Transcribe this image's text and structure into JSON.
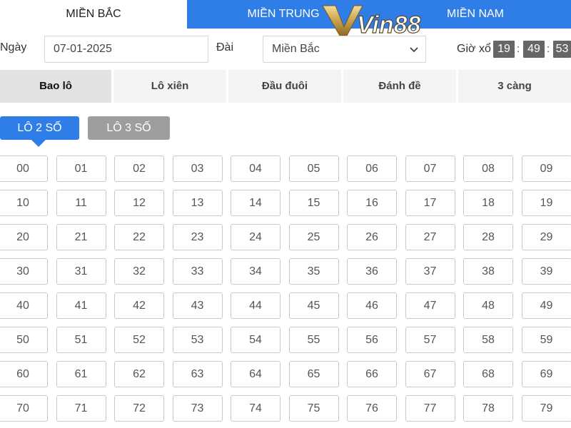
{
  "regions": {
    "items": [
      "MIỀN BẮC",
      "MIỀN TRUNG",
      "MIỀN NAM"
    ],
    "active": 0
  },
  "logo": {
    "text": "Vin88"
  },
  "filters": {
    "date_label": "Ngày",
    "date_value": "07-01-2025",
    "station_label": "Đài",
    "station_value": "Miền Bắc",
    "time_label": "Giờ xổ",
    "time": {
      "h": "19",
      "m": "49",
      "s": "53"
    }
  },
  "bet_tabs": {
    "items": [
      "Bao lô",
      "Lô xiên",
      "Đầu đuôi",
      "Đánh đề",
      "3 càng"
    ],
    "active": 0
  },
  "lo_tabs": {
    "items": [
      "LÔ 2 SỐ",
      "LÔ 3 SỐ"
    ],
    "active": 0
  },
  "numbers": [
    "00",
    "01",
    "02",
    "03",
    "04",
    "05",
    "06",
    "07",
    "08",
    "09",
    "10",
    "11",
    "12",
    "13",
    "14",
    "15",
    "16",
    "17",
    "18",
    "19",
    "20",
    "21",
    "22",
    "23",
    "24",
    "25",
    "26",
    "27",
    "28",
    "29",
    "30",
    "31",
    "32",
    "33",
    "34",
    "35",
    "36",
    "37",
    "38",
    "39",
    "40",
    "41",
    "42",
    "43",
    "44",
    "45",
    "46",
    "47",
    "48",
    "49",
    "50",
    "51",
    "52",
    "53",
    "54",
    "55",
    "56",
    "57",
    "58",
    "59",
    "60",
    "61",
    "62",
    "63",
    "64",
    "65",
    "66",
    "67",
    "68",
    "69",
    "70",
    "71",
    "72",
    "73",
    "74",
    "75",
    "76",
    "77",
    "78",
    "79"
  ],
  "colors": {
    "primary": "#2f7ee8",
    "inactive_tab": "#9e9e9e",
    "time_box": "#666666",
    "logo_gold": "#c9a24a"
  }
}
